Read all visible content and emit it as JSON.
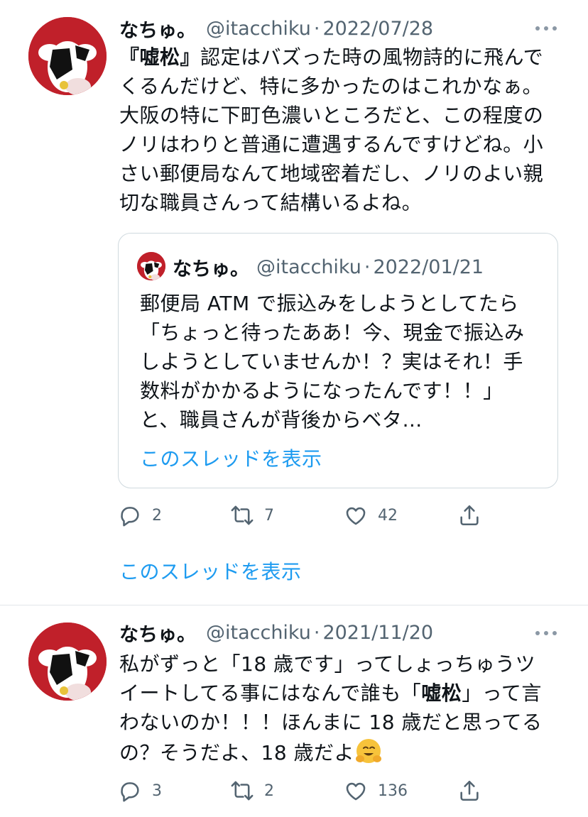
{
  "tweet1": {
    "name": "なちゅ。",
    "handle": "@itacchiku",
    "dot": "·",
    "date": "2022/07/28",
    "body_bold": "『嘘松』",
    "body_rest": "認定はバズった時の風物詩的に飛んでくるんだけど、特に多かったのはこれかなぁ。大阪の特に下町色濃いところだと、この程度のノリはわりと普通に遭遇するんですけどね。小さい郵便局なんて地域密着だし、ノリのよい親切な職員さんって結構いるよね。",
    "quote": {
      "name": "なちゅ。",
      "handle": "@itacchiku",
      "dot": "·",
      "date": "2022/01/21",
      "body": "郵便局 ATM で振込みをしようとしてたら「ちょっと待ったああ！今、現金で振込みしようとしていませんか！？実はそれ！手数料がかかるようになったんです！！」と、職員さんが背後からベタ…",
      "show_thread": "このスレッドを表示"
    },
    "replies": "2",
    "retweets": "7",
    "likes": "42",
    "show_thread": "このスレッドを表示"
  },
  "tweet2": {
    "name": "なちゅ。",
    "handle": "@itacchiku",
    "dot": "·",
    "date": "2021/11/20",
    "body_part1": "私がずっと「18 歳です」ってしょっちゅうツイートしてる事にはなんで誰も「",
    "body_bold": "嘘松",
    "body_part2": "」って言わないのか！！！ほんまに 18 歳だと思ってるの？そうだよ、18 歳だよ",
    "emoji": "hugging-face-emoji",
    "replies": "3",
    "retweets": "2",
    "likes": "136"
  },
  "icons": {
    "reply": "reply-icon",
    "retweet": "retweet-icon",
    "like": "like-icon",
    "share": "share-icon",
    "more": "more-icon"
  },
  "colors": {
    "link": "#1d9bf0",
    "secondary": "#536471",
    "avatar_bg": "#c0202a"
  }
}
